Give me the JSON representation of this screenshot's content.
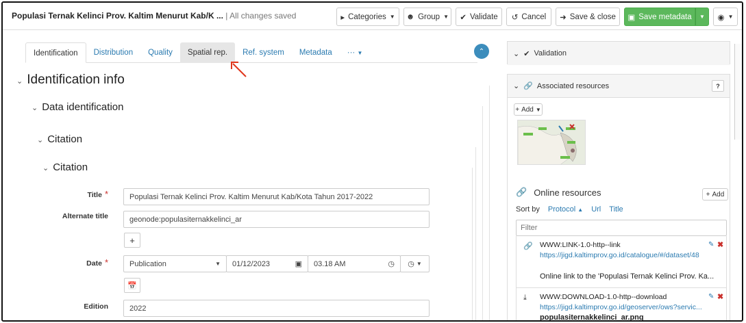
{
  "header": {
    "title": "Populasi Ternak Kelinci Prov. Kaltim Menurut Kab/K ...",
    "saved_status": "| All changes saved",
    "categories_label": "Categories",
    "group_label": "Group",
    "validate_label": "Validate",
    "cancel_label": "Cancel",
    "save_close_label": "Save & close",
    "save_metadata_label": "Save metadata"
  },
  "tabs": [
    "Identification",
    "Distribution",
    "Quality",
    "Spatial rep.",
    "Ref. system",
    "Metadata",
    "···"
  ],
  "form": {
    "section_identification": "Identification info",
    "section_data_identification": "Data identification",
    "section_citation_outer": "Citation",
    "section_citation_inner": "Citation",
    "title_label": "Title",
    "title_value": "Populasi Ternak Kelinci Prov. Kaltim Menurut Kab/Kota Tahun 2017-2022",
    "alternate_title_label": "Alternate title",
    "alternate_title_value": "geonode:populasiternakkelinci_ar",
    "date_label": "Date",
    "date_type": "Publication",
    "date_value": "01/12/2023",
    "time_value": "03.18 AM",
    "edition_label": "Edition",
    "edition_value": "2022"
  },
  "sidebar": {
    "validation_label": "Validation",
    "associated_label": "Associated resources",
    "add_label": "Add",
    "online_resources_label": "Online resources",
    "online_add_label": "Add",
    "sort_by_label": "Sort by",
    "sort_protocol": "Protocol",
    "sort_url": "Url",
    "sort_title": "Title",
    "filter_placeholder": "Filter",
    "resources": [
      {
        "protocol": "WWW:LINK-1.0-http--link",
        "url": "https://jigd.kaltimprov.go.id/catalogue/#/dataset/48",
        "description": "Online link to the 'Populasi Ternak Kelinci Prov. Ka..."
      },
      {
        "protocol": "WWW:DOWNLOAD-1.0-http--download",
        "url": "https://jigd.kaltimprov.go.id/geoserver/ows?servic...",
        "description": "populasiternakkelinci_ar.png"
      }
    ]
  },
  "colors": {
    "accent": "#2a7ab0",
    "save_green": "#5cb85c",
    "required": "#c9302c",
    "arrow": "#e0361c"
  }
}
